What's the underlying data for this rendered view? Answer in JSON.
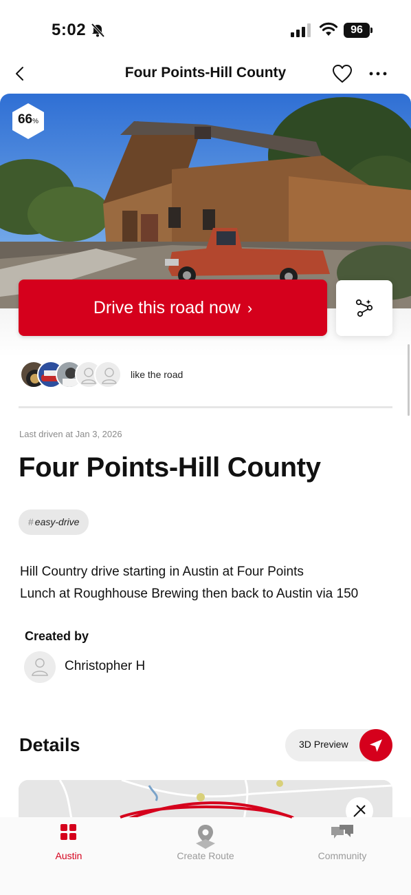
{
  "status_bar": {
    "time": "5:02",
    "battery": "96"
  },
  "header": {
    "title": "Four Points-Hill County"
  },
  "hero": {
    "score_value": "66",
    "score_unit": "%"
  },
  "cta": {
    "drive_label": "Drive this road now",
    "drive_chevron": "›"
  },
  "likes": {
    "text": "like the road",
    "avatar_count": 5
  },
  "route": {
    "last_driven": "Last driven at Jan 3, 2026",
    "title": "Four Points-Hill County",
    "tags": [
      {
        "hash": "#",
        "label": "easy-drive"
      }
    ],
    "description_line_1": "Hill Country drive starting in Austin at Four Points",
    "description_line_2": "Lunch at Roughhouse Brewing then back to Austin via 150"
  },
  "creator": {
    "label": "Created by",
    "name": "Christopher H"
  },
  "details": {
    "title": "Details",
    "preview_label": "3D Preview"
  },
  "tabbar": {
    "tabs": [
      {
        "label": "Austin",
        "icon": "grid-icon",
        "active": true
      },
      {
        "label": "Create Route",
        "icon": "map-pin-icon",
        "active": false
      },
      {
        "label": "Community",
        "icon": "chat-bubbles-icon",
        "active": false
      }
    ]
  },
  "colors": {
    "accent": "#d5001c",
    "text": "#111111",
    "muted": "#8a8a8a"
  }
}
